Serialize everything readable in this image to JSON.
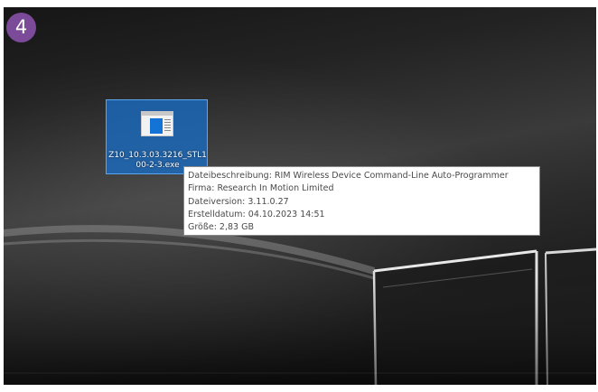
{
  "step_badge": "4",
  "desktop_icon": {
    "icon": "exe-file-icon",
    "label": "Z10_10.3.03.3216_STL100-2-3.exe"
  },
  "tooltip": {
    "lines": [
      "Dateibeschreibung: RIM Wireless Device Command-Line Auto-Programmer",
      "Firma: Research In Motion Limited",
      "Dateiversion: 3.11.0.27",
      "Erstelldatum: 04.10.2023 14:51",
      "Größe: 2,83 GB"
    ]
  },
  "colors": {
    "badge": "#7b4a98",
    "icon_selection": "#1a6dc4",
    "tooltip_bg": "#ffffff",
    "tooltip_text": "#4a4a4a"
  }
}
